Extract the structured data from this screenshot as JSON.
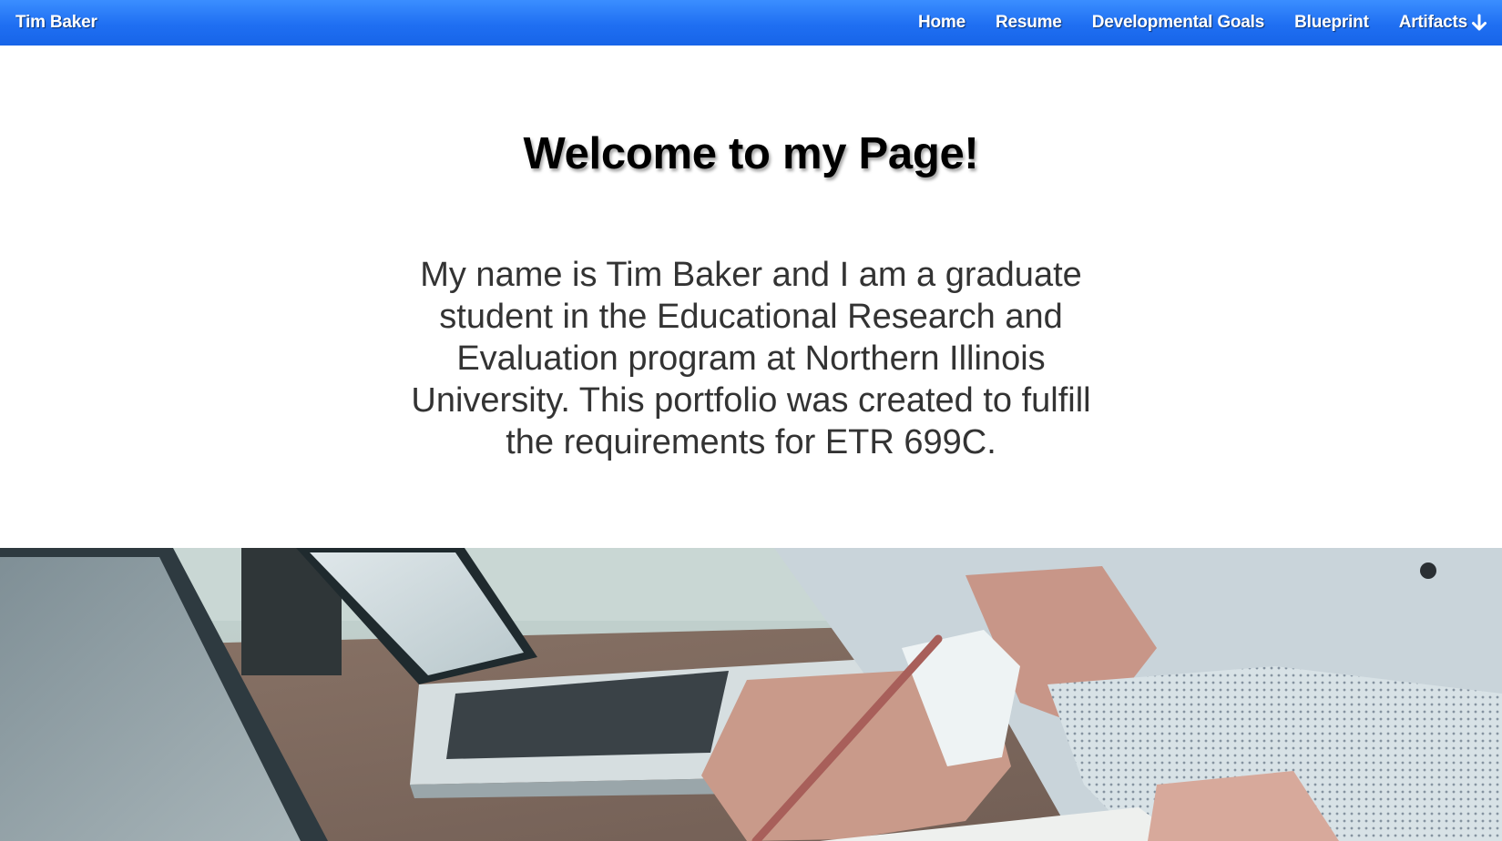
{
  "navbar": {
    "brand": "Tim Baker",
    "links": [
      {
        "label": "Home"
      },
      {
        "label": "Resume"
      },
      {
        "label": "Developmental Goals"
      },
      {
        "label": "Blueprint"
      },
      {
        "label": "Artifacts",
        "icon": "arrow-down-icon"
      }
    ],
    "colors": {
      "background": "#1f6ff2",
      "text": "#ffffff"
    }
  },
  "main": {
    "title": "Welcome to my Page!",
    "intro": "My name is Tim Baker and I am a graduate student in the Educational Research and Evaluation program at Northern Illinois University. This portfolio was created to fulfill the requirements for ETR 699C."
  }
}
